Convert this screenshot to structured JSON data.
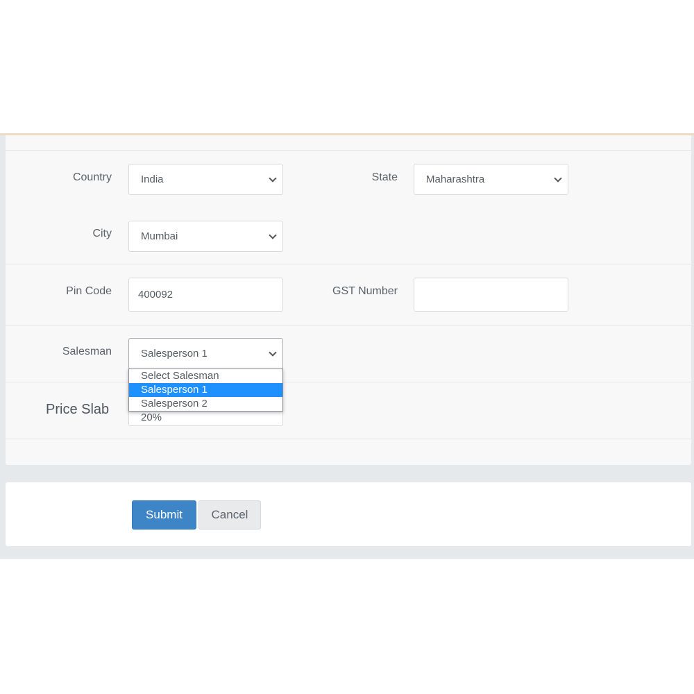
{
  "form": {
    "country": {
      "label": "Country",
      "value": "India"
    },
    "state": {
      "label": "State",
      "value": "Maharashtra"
    },
    "city": {
      "label": "City",
      "value": "Mumbai"
    },
    "pin_code": {
      "label": "Pin Code",
      "value": "400092"
    },
    "gst_number": {
      "label": "GST Number",
      "value": ""
    },
    "salesman": {
      "label": "Salesman",
      "value": "Salesperson 1",
      "options": [
        "Select Salesman",
        "Salesperson 1",
        "Salesperson 2"
      ]
    },
    "price_slab": {
      "label": "Price Slab",
      "value": "20%"
    }
  },
  "actions": {
    "submit_label": "Submit",
    "cancel_label": "Cancel"
  },
  "colors": {
    "primary": "#3d85c6",
    "highlight": "#1e90ff"
  }
}
